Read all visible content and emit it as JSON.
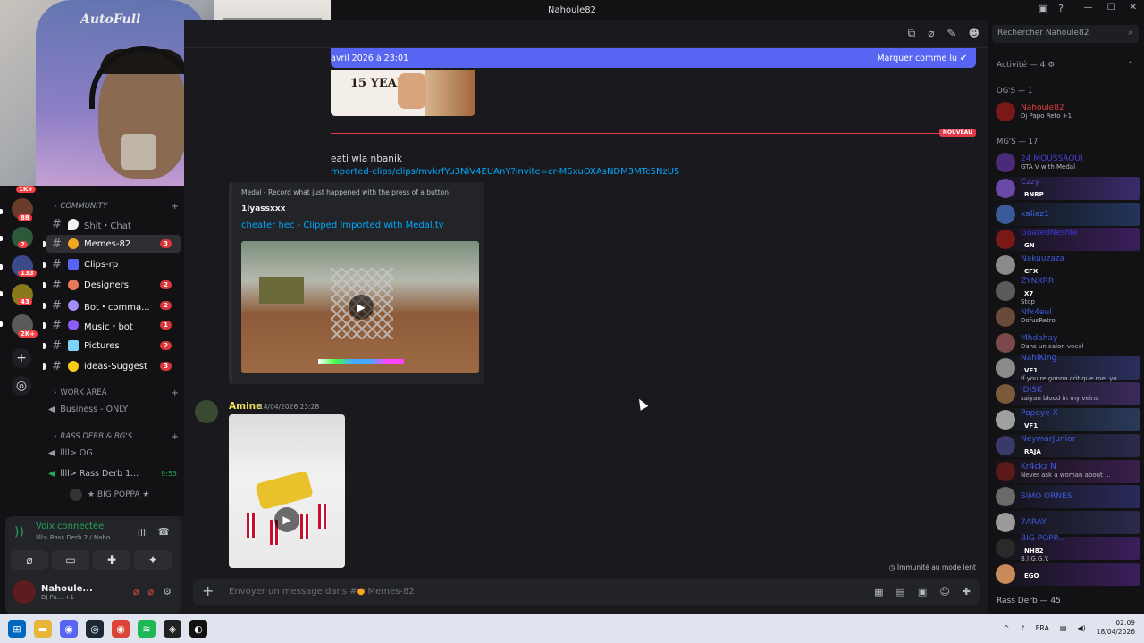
{
  "window": {
    "title": "Nahoule82"
  },
  "topbar": {
    "search_placeholder": "Rechercher Nahoule82"
  },
  "new_messages_bar": {
    "text": "avril 2026 à 23:01",
    "action": "Marquer comme lu"
  },
  "image_text": "15 YEAR",
  "new_divider": "NOUVEAU",
  "rail_badges": [
    "1K+",
    "88",
    "2",
    "133",
    "43",
    "2K+"
  ],
  "channels": {
    "cat1": "COMMUNITY",
    "items": [
      {
        "label": "Shit・Chat",
        "badge": ""
      },
      {
        "label": "Memes-82",
        "badge": "3"
      },
      {
        "label": "Clips-rp",
        "badge": ""
      },
      {
        "label": "Designers",
        "badge": "2"
      },
      {
        "label": "Bot・comma...",
        "badge": "2"
      },
      {
        "label": "Music・bot",
        "badge": "1"
      },
      {
        "label": "Pictures",
        "badge": "2"
      },
      {
        "label": "ideas-Suggest",
        "badge": "3"
      }
    ],
    "cat2": "WORK AREA",
    "voice1": "Business - ONLY",
    "cat3": "RASS DERB & BG'S",
    "voice2": "llll> OG",
    "voice3": "llll> Rass Derb 1...",
    "voice3_time": "9:53",
    "voice_user": "★ BIG POPPA ★"
  },
  "voice_panel": {
    "title": "Voix connectée",
    "sub": "llll> Rass Derb 2 / Naho..."
  },
  "user_panel": {
    "name": "Nahoule...",
    "status": "Dj Pa...",
    "extra": "+1"
  },
  "messages": {
    "m1_text": "eati wla nbanik",
    "m1_link": "mported-clips/clips/mvkrfYu3NiV4EUAnY?invite=cr-MSxuOXAsNDM3MTc5NzU5",
    "embed_provider": "Medal - Record what just happened with the press of a button",
    "embed_author": "1lyassxxx",
    "embed_title": "cheater hec - Clipped Imported with Medal.tv",
    "m2_author": "Amine",
    "m2_time": "14/04/2026 23:28"
  },
  "slowmode": "Immunité au mode lent",
  "composer": {
    "placeholder": "Envoyer un message dans #",
    "channel": "Memes-82"
  },
  "right": {
    "activity": "Activité — 4",
    "og_group": "OG'S — 1",
    "mg_group": "MG'S — 17",
    "members_top": [
      {
        "name": "Nahoule82",
        "status": "Dj Papo Reto +1",
        "tag": "",
        "color": "#e23b3b",
        "av": "#7a1818"
      }
    ],
    "members": [
      {
        "name": "24 MOUSSAOUI",
        "status": "GTA V with Medal",
        "tag": "",
        "color": "#4a3fd6",
        "av": "#4b2a7a",
        "bg": ""
      },
      {
        "name": "Czzy",
        "status": "",
        "tag": "BNRP",
        "color": "#5a4ad0",
        "av": "#6a4aa8",
        "bg": "#3b2a6b"
      },
      {
        "name": "xaliaz1",
        "status": "",
        "tag": "",
        "color": "#3f64e0",
        "av": "#3a5a9a",
        "bg": "#24345c"
      },
      {
        "name": "GoatedNeshie",
        "status": "",
        "tag": "GN",
        "color": "#3a3ad6",
        "av": "#7a1818",
        "bg": "#3a1f5c"
      },
      {
        "name": "Nakuuzaza",
        "status": "",
        "tag": "CFX",
        "color": "#3f5ae0",
        "av": "#8a8a8a",
        "bg": ""
      },
      {
        "name": "ZYNXRR",
        "status": "Stop",
        "tag": "X7",
        "color": "#3f5ae0",
        "av": "#5a5a5a",
        "bg": ""
      },
      {
        "name": "Nfx4eul",
        "status": "DofusRetro",
        "tag": "",
        "color": "#3f5ae0",
        "av": "#6a4a3a",
        "bg": ""
      },
      {
        "name": "Mhdahay",
        "status": "Dans un salon vocal",
        "tag": "",
        "color": "#3f5ae0",
        "av": "#7a4a4a",
        "bg": ""
      },
      {
        "name": "NahiKing",
        "status": "If you're gonna critique me, yo...",
        "tag": "VF1",
        "color": "#3f5ae0",
        "av": "#8a8a8a",
        "bg": "#2a2f5c"
      },
      {
        "name": "IDISK",
        "status": "saiyan blood in my veins",
        "tag": "",
        "color": "#3f5ae0",
        "av": "#7a5a3a",
        "bg": "#3a2a5c"
      },
      {
        "name": "Popeye X",
        "status": "",
        "tag": "VF1",
        "color": "#3f5ae0",
        "av": "#a0a0a0",
        "bg": "#2a3a5c"
      },
      {
        "name": "NeymarJunior",
        "status": "",
        "tag": "RAJA",
        "color": "#3f5ae0",
        "av": "#3a3a6a",
        "bg": "#2a2a4c"
      },
      {
        "name": "Kr4ckz N",
        "status": "Never ask a woman about ...",
        "tag": "",
        "color": "#3f5ae0",
        "av": "#5a1a1a",
        "bg": "#3a1f4c"
      },
      {
        "name": "SIMO ORNES",
        "status": "",
        "tag": "",
        "color": "#3f5ae0",
        "av": "#6a6a6a",
        "bg": "#2a2a5c"
      },
      {
        "name": "7ARAY",
        "status": "",
        "tag": "",
        "color": "#3f5ae0",
        "av": "#9a9a9a",
        "bg": "#2a2a4c"
      },
      {
        "name": "BIG POPP...",
        "status": "B.I.G.G.Y.",
        "tag": "NH82",
        "color": "#3f5ae0",
        "av": "#2a2a2a",
        "bg": "#3a1f5c"
      },
      {
        "name": "",
        "status": "",
        "tag": "EGO",
        "color": "#3f5ae0",
        "av": "#c88a5a",
        "bg": "#3a1f5c"
      }
    ],
    "footer": "Rass Derb — 45"
  },
  "tray": {
    "lang": "FRA",
    "time": "02:09",
    "date": "18/04/2026"
  }
}
